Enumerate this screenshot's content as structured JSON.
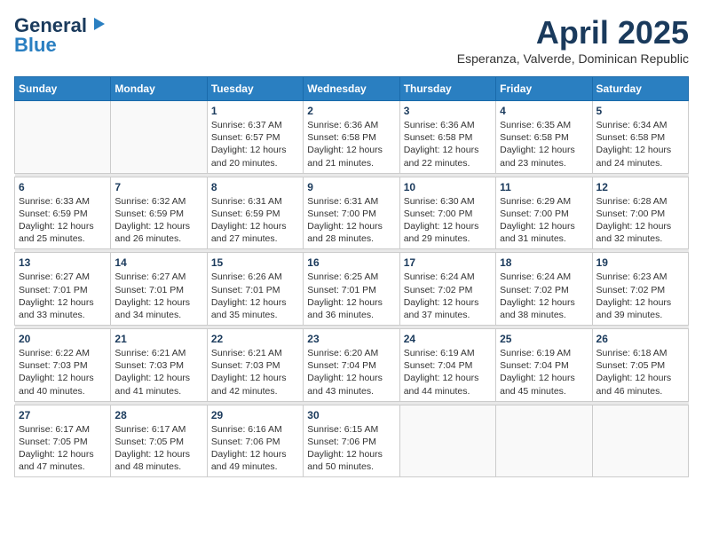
{
  "logo": {
    "line1": "General",
    "line2": "Blue"
  },
  "title": "April 2025",
  "subtitle": "Esperanza, Valverde, Dominican Republic",
  "days_header": [
    "Sunday",
    "Monday",
    "Tuesday",
    "Wednesday",
    "Thursday",
    "Friday",
    "Saturday"
  ],
  "weeks": [
    [
      {
        "day": "",
        "info": ""
      },
      {
        "day": "",
        "info": ""
      },
      {
        "day": "1",
        "info": "Sunrise: 6:37 AM\nSunset: 6:57 PM\nDaylight: 12 hours and 20 minutes."
      },
      {
        "day": "2",
        "info": "Sunrise: 6:36 AM\nSunset: 6:58 PM\nDaylight: 12 hours and 21 minutes."
      },
      {
        "day": "3",
        "info": "Sunrise: 6:36 AM\nSunset: 6:58 PM\nDaylight: 12 hours and 22 minutes."
      },
      {
        "day": "4",
        "info": "Sunrise: 6:35 AM\nSunset: 6:58 PM\nDaylight: 12 hours and 23 minutes."
      },
      {
        "day": "5",
        "info": "Sunrise: 6:34 AM\nSunset: 6:58 PM\nDaylight: 12 hours and 24 minutes."
      }
    ],
    [
      {
        "day": "6",
        "info": "Sunrise: 6:33 AM\nSunset: 6:59 PM\nDaylight: 12 hours and 25 minutes."
      },
      {
        "day": "7",
        "info": "Sunrise: 6:32 AM\nSunset: 6:59 PM\nDaylight: 12 hours and 26 minutes."
      },
      {
        "day": "8",
        "info": "Sunrise: 6:31 AM\nSunset: 6:59 PM\nDaylight: 12 hours and 27 minutes."
      },
      {
        "day": "9",
        "info": "Sunrise: 6:31 AM\nSunset: 7:00 PM\nDaylight: 12 hours and 28 minutes."
      },
      {
        "day": "10",
        "info": "Sunrise: 6:30 AM\nSunset: 7:00 PM\nDaylight: 12 hours and 29 minutes."
      },
      {
        "day": "11",
        "info": "Sunrise: 6:29 AM\nSunset: 7:00 PM\nDaylight: 12 hours and 31 minutes."
      },
      {
        "day": "12",
        "info": "Sunrise: 6:28 AM\nSunset: 7:00 PM\nDaylight: 12 hours and 32 minutes."
      }
    ],
    [
      {
        "day": "13",
        "info": "Sunrise: 6:27 AM\nSunset: 7:01 PM\nDaylight: 12 hours and 33 minutes."
      },
      {
        "day": "14",
        "info": "Sunrise: 6:27 AM\nSunset: 7:01 PM\nDaylight: 12 hours and 34 minutes."
      },
      {
        "day": "15",
        "info": "Sunrise: 6:26 AM\nSunset: 7:01 PM\nDaylight: 12 hours and 35 minutes."
      },
      {
        "day": "16",
        "info": "Sunrise: 6:25 AM\nSunset: 7:01 PM\nDaylight: 12 hours and 36 minutes."
      },
      {
        "day": "17",
        "info": "Sunrise: 6:24 AM\nSunset: 7:02 PM\nDaylight: 12 hours and 37 minutes."
      },
      {
        "day": "18",
        "info": "Sunrise: 6:24 AM\nSunset: 7:02 PM\nDaylight: 12 hours and 38 minutes."
      },
      {
        "day": "19",
        "info": "Sunrise: 6:23 AM\nSunset: 7:02 PM\nDaylight: 12 hours and 39 minutes."
      }
    ],
    [
      {
        "day": "20",
        "info": "Sunrise: 6:22 AM\nSunset: 7:03 PM\nDaylight: 12 hours and 40 minutes."
      },
      {
        "day": "21",
        "info": "Sunrise: 6:21 AM\nSunset: 7:03 PM\nDaylight: 12 hours and 41 minutes."
      },
      {
        "day": "22",
        "info": "Sunrise: 6:21 AM\nSunset: 7:03 PM\nDaylight: 12 hours and 42 minutes."
      },
      {
        "day": "23",
        "info": "Sunrise: 6:20 AM\nSunset: 7:04 PM\nDaylight: 12 hours and 43 minutes."
      },
      {
        "day": "24",
        "info": "Sunrise: 6:19 AM\nSunset: 7:04 PM\nDaylight: 12 hours and 44 minutes."
      },
      {
        "day": "25",
        "info": "Sunrise: 6:19 AM\nSunset: 7:04 PM\nDaylight: 12 hours and 45 minutes."
      },
      {
        "day": "26",
        "info": "Sunrise: 6:18 AM\nSunset: 7:05 PM\nDaylight: 12 hours and 46 minutes."
      }
    ],
    [
      {
        "day": "27",
        "info": "Sunrise: 6:17 AM\nSunset: 7:05 PM\nDaylight: 12 hours and 47 minutes."
      },
      {
        "day": "28",
        "info": "Sunrise: 6:17 AM\nSunset: 7:05 PM\nDaylight: 12 hours and 48 minutes."
      },
      {
        "day": "29",
        "info": "Sunrise: 6:16 AM\nSunset: 7:06 PM\nDaylight: 12 hours and 49 minutes."
      },
      {
        "day": "30",
        "info": "Sunrise: 6:15 AM\nSunset: 7:06 PM\nDaylight: 12 hours and 50 minutes."
      },
      {
        "day": "",
        "info": ""
      },
      {
        "day": "",
        "info": ""
      },
      {
        "day": "",
        "info": ""
      }
    ]
  ]
}
